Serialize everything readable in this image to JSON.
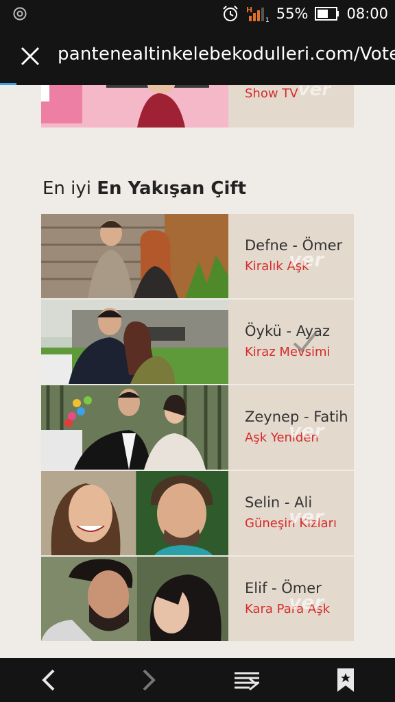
{
  "status_bar": {
    "battery_percent": "55%",
    "time": "08:00",
    "signal_label": "H"
  },
  "browser": {
    "url": "pantenealtinkelebekodulleri.com/Vote"
  },
  "top_item": {
    "show": "Show TV",
    "watermark": "ver"
  },
  "section": {
    "prefix": "En iyi",
    "title": "En Yakışan Çift"
  },
  "nominees": [
    {
      "couple": "Defne - Ömer",
      "show": "Kiralık Aşk",
      "voted": false
    },
    {
      "couple": "Öykü - Ayaz",
      "show": "Kiraz Mevsimi",
      "voted": true
    },
    {
      "couple": "Zeynep - Fatih",
      "show": "Aşk Yeniden",
      "voted": false
    },
    {
      "couple": "Selin - Ali",
      "show": "Güneşin Kızları",
      "voted": false
    },
    {
      "couple": "Elif - Ömer",
      "show": "Kara Para Aşk",
      "voted": false
    }
  ],
  "colors": {
    "accent_red": "#d62b2b",
    "card_bg": "#e3d9cd",
    "page_bg": "#efebe6",
    "bar_bg": "#141414",
    "progress_blue": "#3aa0e8"
  },
  "icons": {
    "close": "close-icon",
    "back": "back-icon",
    "forward": "forward-icon",
    "tabs": "tabs-icon",
    "bookmark": "bookmark-icon",
    "alarm": "alarm-icon",
    "signal": "signal-icon",
    "battery": "battery-icon",
    "check": "check-icon"
  }
}
